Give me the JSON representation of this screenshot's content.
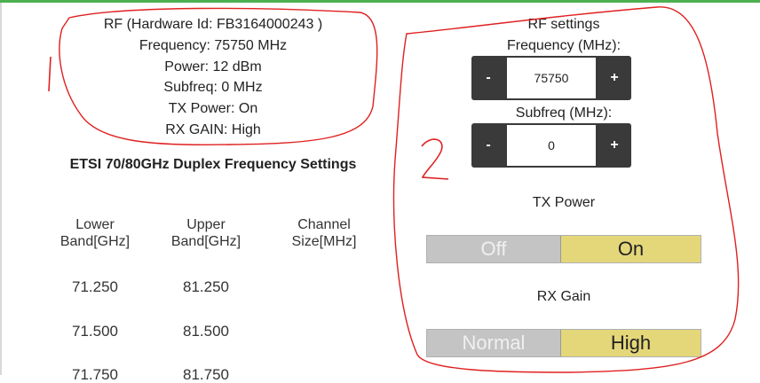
{
  "rf_info": {
    "hardware_line": "RF (Hardware Id: FB3164000243 )",
    "frequency_line": "Frequency: 75750 MHz",
    "power_line": "Power: 12 dBm",
    "subfreq_line": "Subfreq: 0 MHz",
    "tx_power_line": "TX Power: On",
    "rx_gain_line": "RX GAIN: High"
  },
  "etsi": {
    "title": "ETSI 70/80GHz Duplex Frequency Settings",
    "columns": {
      "lower_1": "Lower",
      "lower_2": "Band[GHz]",
      "upper_1": "Upper",
      "upper_2": "Band[GHz]",
      "channel_1": "Channel",
      "channel_2": "Size[MHz]"
    },
    "rows": [
      {
        "lower": "71.250",
        "upper": "81.250"
      },
      {
        "lower": "71.500",
        "upper": "81.500"
      },
      {
        "lower": "71.750",
        "upper": "81.750"
      }
    ]
  },
  "rf_settings": {
    "title": "RF settings",
    "frequency_label": "Frequency (MHz):",
    "frequency_value": "75750",
    "subfreq_label": "Subfreq (MHz):",
    "subfreq_value": "0",
    "minus": "-",
    "plus": "+",
    "tx_power_label": "TX Power",
    "tx_off": "Off",
    "tx_on": "On",
    "rx_gain_label": "RX Gain",
    "rx_normal": "Normal",
    "rx_high": "High"
  },
  "annotations": {
    "label_1": "1",
    "label_2": "2",
    "color": "#e02020"
  },
  "colors": {
    "top_bar": "#4caf50",
    "stepper_bg": "#3a3a3a",
    "toggle_active": "#e4d77a",
    "toggle_inactive": "#c4c4c4"
  }
}
